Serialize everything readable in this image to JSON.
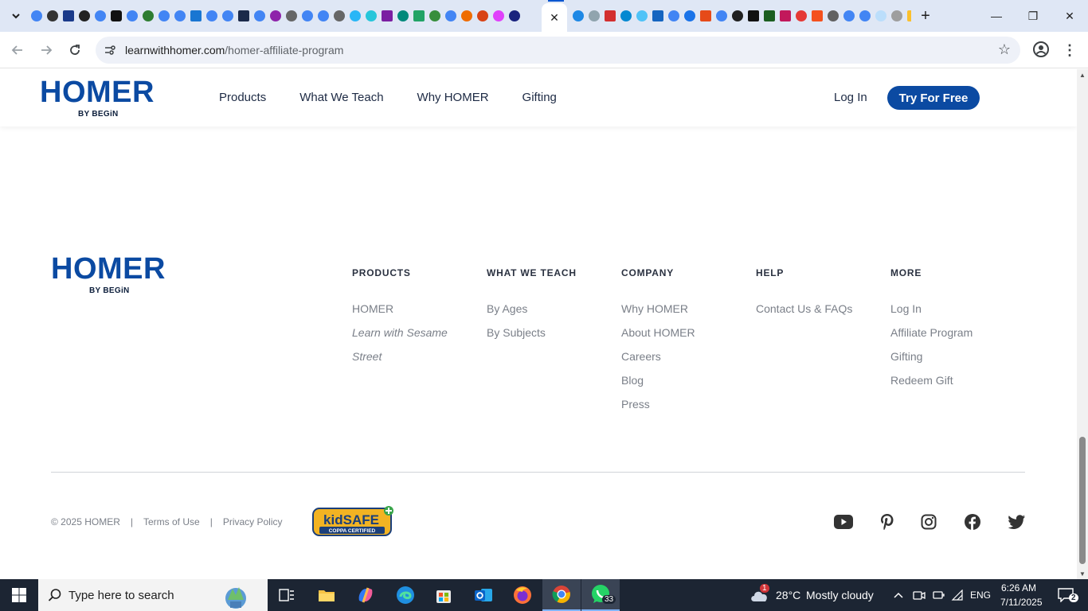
{
  "browser": {
    "active_tab_close": "✕",
    "new_tab": "+",
    "url_host": "learnwithhomer.com",
    "url_path": "/homer-affiliate-program",
    "window_controls": {
      "minimize": "—",
      "maximize": "❐",
      "close": "✕"
    }
  },
  "site_header": {
    "logo_word": "HOMER",
    "logo_sub": "BY BEGiN",
    "nav": [
      "Products",
      "What We Teach",
      "Why HOMER",
      "Gifting"
    ],
    "login": "Log In",
    "cta": "Try For Free"
  },
  "footer": {
    "logo_word": "HOMER",
    "logo_sub": "BY BEGiN",
    "columns": [
      {
        "heading": "PRODUCTS",
        "links": [
          "HOMER",
          "Learn with Sesame",
          "Street"
        ]
      },
      {
        "heading": "WHAT WE TEACH",
        "links": [
          "By Ages",
          "By Subjects"
        ]
      },
      {
        "heading": "COMPANY",
        "links": [
          "Why HOMER",
          "About HOMER",
          "Careers",
          "Blog",
          "Press"
        ]
      },
      {
        "heading": "HELP",
        "links": [
          "Contact Us & FAQs"
        ]
      },
      {
        "heading": "MORE",
        "links": [
          "Log In",
          "Affiliate Program",
          "Gifting",
          "Redeem Gift"
        ]
      }
    ],
    "copyright": "© 2025 HOMER",
    "separator": "|",
    "terms": "Terms of Use",
    "privacy": "Privacy Policy",
    "kidsafe_top": "kidSAFE",
    "kidsafe_bottom": "COPPA CERTIFIED",
    "social_icons": [
      "youtube-icon",
      "pinterest-icon",
      "instagram-icon",
      "facebook-icon",
      "twitter-icon"
    ]
  },
  "taskbar": {
    "search_placeholder": "Type here to search",
    "weather_temp": "28°C",
    "weather_desc": "Mostly cloudy",
    "weather_badge": "1",
    "language": "ENG",
    "time": "6:26 AM",
    "date": "7/11/2025",
    "notifications": "2",
    "whatsapp_badge": "33"
  },
  "colors": {
    "brand_blue": "#0b4aa2",
    "tabstrip": "#dfe7f5",
    "taskbar": "#1c2533"
  }
}
